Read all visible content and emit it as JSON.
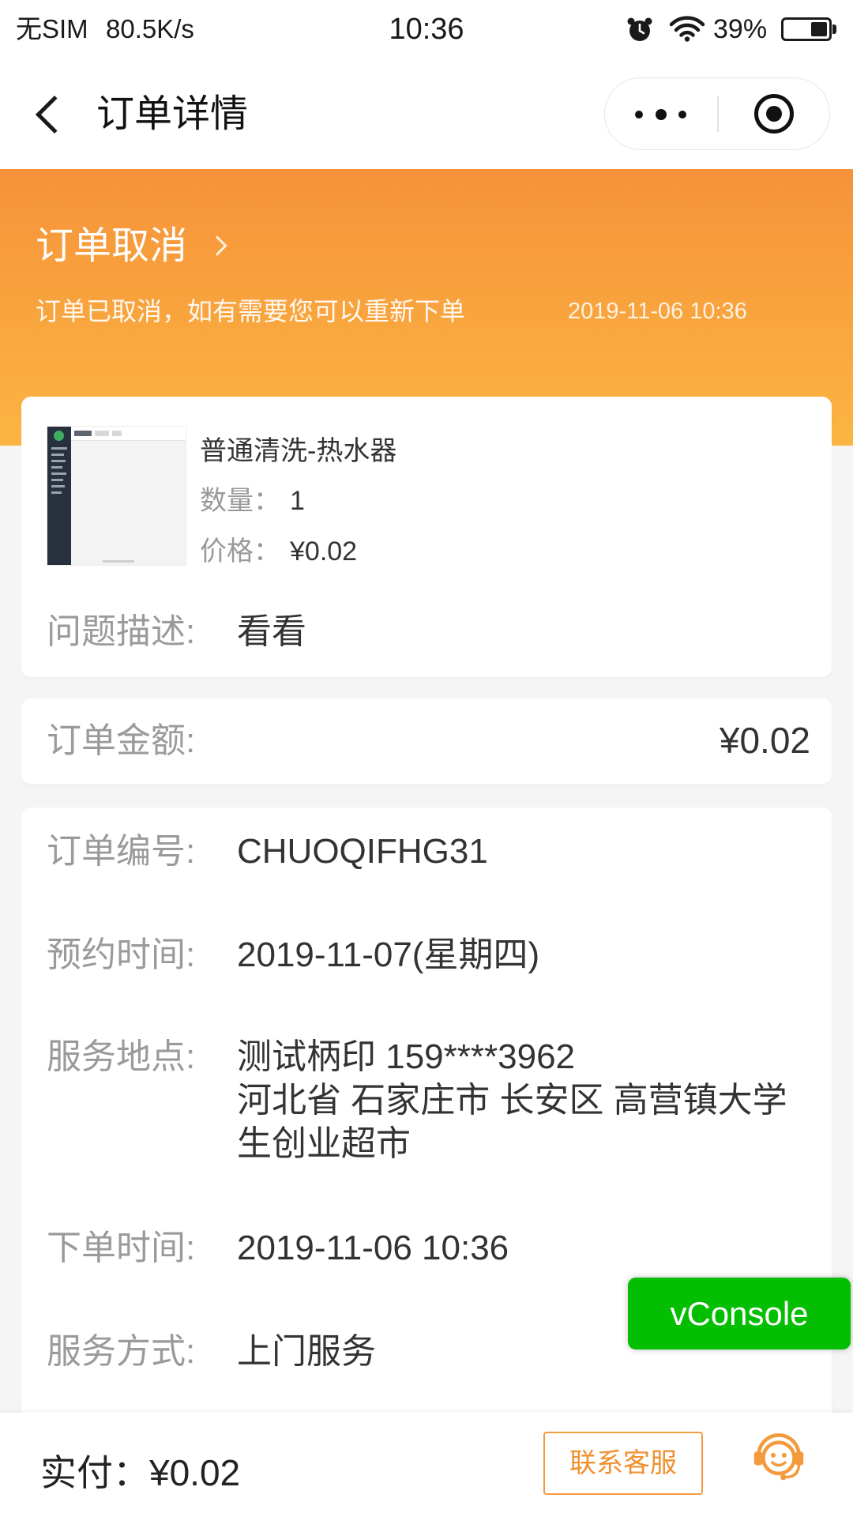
{
  "status_bar": {
    "carrier": "无SIM",
    "network_speed": "80.5K/s",
    "time": "10:36",
    "battery_percent": "39%",
    "battery_level": 0.39,
    "icons": [
      "alarm-clock-icon",
      "wifi-icon",
      "battery-icon"
    ]
  },
  "nav": {
    "title": "订单详情",
    "back_icon": "chevron-left-icon",
    "more_icon": "more-dots-icon",
    "exit_icon": "target-circle-icon"
  },
  "order_status": {
    "title": "订单取消",
    "chevron_icon": "chevron-right-icon",
    "message": "订单已取消，如有需要您可以重新下单",
    "time": "2019-11-06 10:36"
  },
  "product": {
    "thumbnail_icon": "product-thumbnail-image",
    "name": "普通清洗-热水器",
    "quantity_label": "数量：",
    "quantity": "1",
    "price_label": "价格：",
    "price": "¥0.02"
  },
  "problem": {
    "label": "问题描述:",
    "value": "看看"
  },
  "amount": {
    "label": "订单金额:",
    "value": "¥0.02"
  },
  "details": {
    "order_no": {
      "label": "订单编号:",
      "value": "CHUOQIFHG31"
    },
    "appointment": {
      "label": "预约时间:",
      "value": "2019-11-07(星期四)"
    },
    "location": {
      "label": "服务地点:",
      "contact": "测试柄印 159****3962",
      "address": "河北省 石家庄市 长安区 高营镇大学生创业超市"
    },
    "order_time": {
      "label": "下单时间:",
      "value": "2019-11-06 10:36"
    },
    "service_mode": {
      "label": "服务方式:",
      "value": "上门服务"
    }
  },
  "vconsole": {
    "label": "vConsole"
  },
  "bottom_bar": {
    "paid_label": "实付：",
    "paid_amount": "¥0.02",
    "contact_button": "联系客服",
    "service_icon": "customer-service-icon"
  },
  "colors": {
    "header_top": "#f6923a",
    "header_bottom": "#fbb542",
    "accent": "#f39a3d",
    "vconsole": "#04be02",
    "page_bg": "#f5f5f5"
  }
}
